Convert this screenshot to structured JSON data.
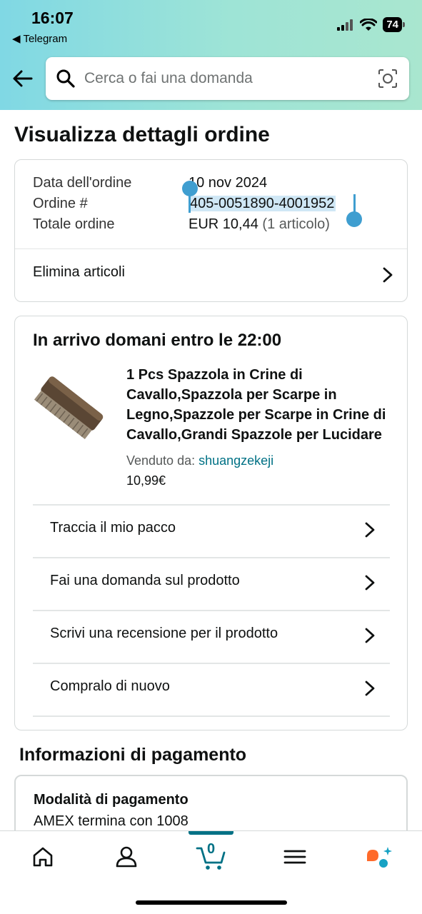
{
  "status_bar": {
    "time": "16:07",
    "back_app": "Telegram",
    "battery": "74"
  },
  "search": {
    "placeholder": "Cerca o fai una domanda"
  },
  "page_title": "Visualizza dettagli ordine",
  "order_summary": {
    "date_label": "Data dell'ordine",
    "date_value": "10 nov 2024",
    "order_label": "Ordine #",
    "order_value": "405-0051890-4001952",
    "total_label": "Totale ordine",
    "total_value": "EUR 10,44",
    "total_count": "(1 articolo)",
    "remove_label": "Elimina articoli"
  },
  "shipment": {
    "arrival": "In arrivo domani entro le 22:00",
    "product_title": "1 Pcs Spazzola in Crine di Cavallo,Spazzola per Scarpe in Legno,Spazzole per Scarpe in Crine di Cavallo,Grandi Spazzole per Lucidare",
    "seller_label": "Venduto da:",
    "seller_name": "shuangzekeji",
    "price": "10,99€",
    "actions": [
      "Traccia il mio pacco",
      "Fai una domanda sul prodotto",
      "Scrivi una recensione per il prodotto",
      "Compralo di nuovo"
    ]
  },
  "payment": {
    "section_title": "Informazioni di pagamento",
    "method_label": "Modalità di pagamento",
    "method_value": "AMEX  termina con 1008"
  },
  "tabbar": {
    "cart_count": "0",
    "tabs": [
      "home-icon",
      "account-icon",
      "cart-icon",
      "menu-icon",
      "assistant-icon"
    ]
  },
  "colors": {
    "accent": "#007185",
    "selection": "#3f9ed0",
    "header_start": "#80d8e4",
    "header_end": "#a9e6cf"
  }
}
